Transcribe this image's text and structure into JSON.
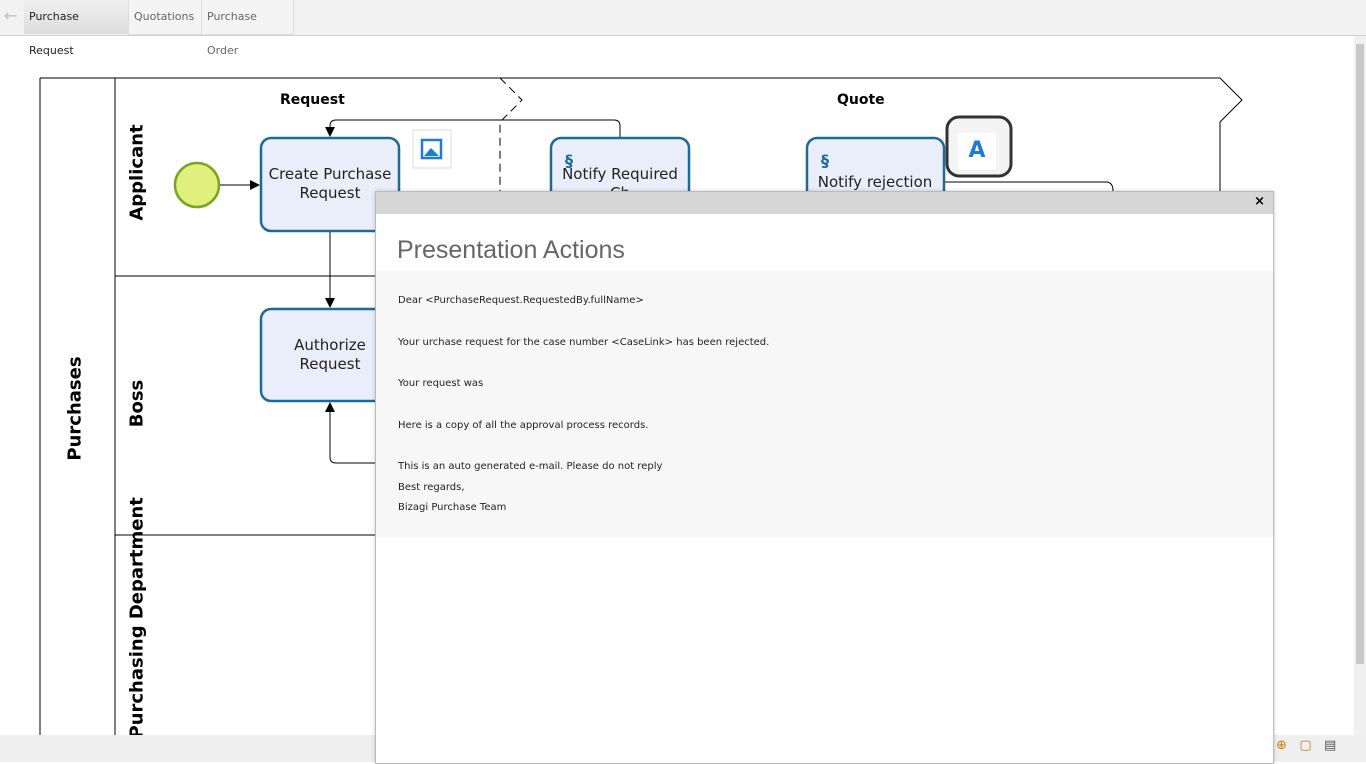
{
  "tabs": {
    "back_icon": "arrow-left-icon",
    "items": [
      {
        "label": "Purchase Request",
        "active": true
      },
      {
        "label": "Quotations"
      },
      {
        "label": "Purchase Order"
      }
    ]
  },
  "diagram": {
    "pool": "Purchases",
    "lanes": [
      "Applicant",
      "Boss",
      "Purchasing Department"
    ],
    "phases": [
      "Request",
      "Quote"
    ],
    "tasks": {
      "create": "Create Purchase Request",
      "authorize": "Authorize Request",
      "notify_required": "Notify Required Ch",
      "notify_rejection": "Notify rejection"
    },
    "badge_letter": "A",
    "colors": {
      "task_fill": "#eaeefb",
      "task_stroke": "#1d6a96",
      "start_fill": "#dff07d",
      "start_stroke": "#7aa51e"
    }
  },
  "modal": {
    "title": "Presentation Actions",
    "close": "×",
    "lines": [
      "Dear <PurchaseRequest.RequestedBy.fullName>",
      "Your urchase request for the case number <CaseLink> has been rejected.",
      "Your request was",
      "Here is a copy of all the approval process records.",
      "This is an auto generated e-mail. Please do not reply",
      "Best regards,",
      "Bizagi Purchase Team"
    ]
  },
  "toolbar": {
    "icons": [
      "zoom-in-icon",
      "zoom-fit-icon",
      "presentation-icon"
    ]
  }
}
